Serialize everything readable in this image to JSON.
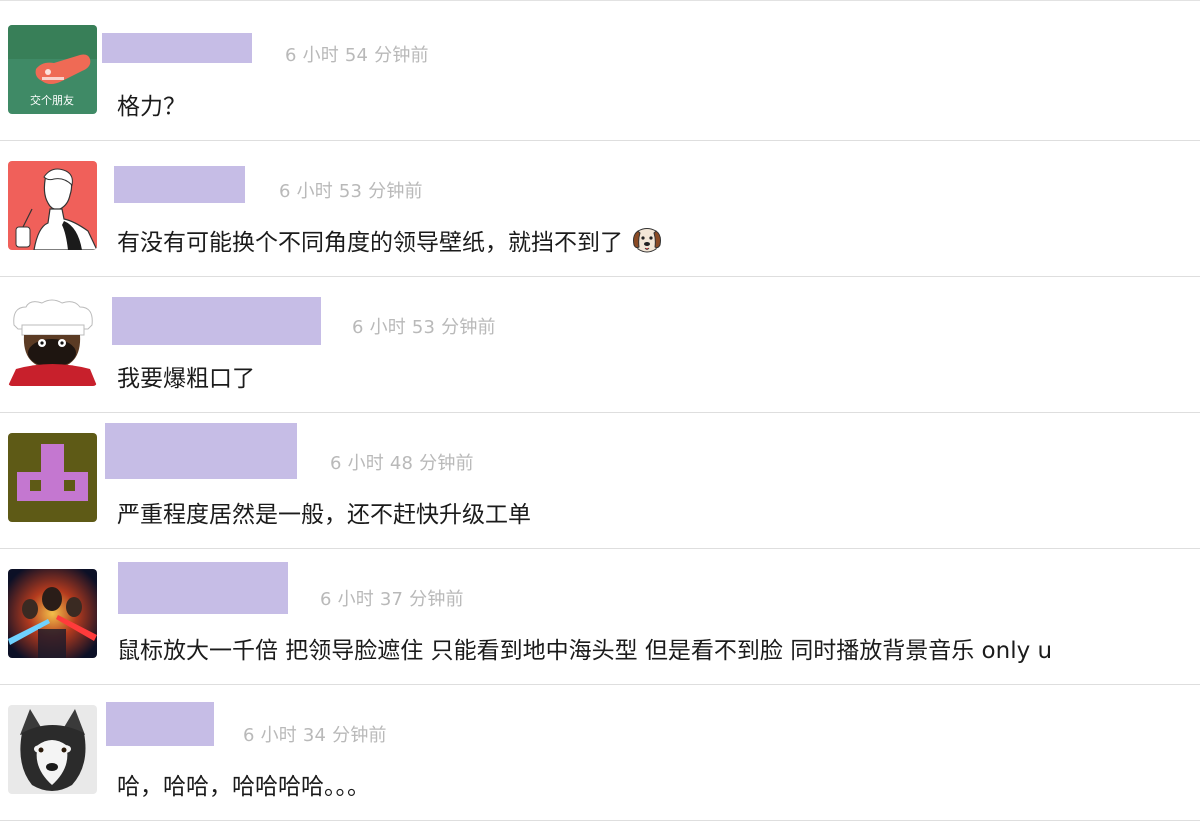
{
  "comments": [
    {
      "avatar_icon": "green-avatar-hand-icon",
      "avatar_text": "交个朋友",
      "time": "6 小时 54 分钟前",
      "content": "格力？"
    },
    {
      "avatar_icon": "red-avatar-sketch-person-icon",
      "time": "6 小时 53 分钟前",
      "content": "有没有可能换个不同角度的领导壁纸，就挡不到了"
    },
    {
      "avatar_icon": "chef-cartoon-avatar-icon",
      "time": "6 小时 53 分钟前",
      "content": "我要爆粗口了"
    },
    {
      "avatar_icon": "purple-pixel-identicon",
      "time": "6 小时 48 分钟前",
      "content": "严重程度居然是一般，还不赶快升级工单"
    },
    {
      "avatar_icon": "starwars-poster-avatar-icon",
      "time": "6 小时 37 分钟前",
      "content": "鼠标放大一千倍 把领导脸遮住 只能看到地中海头型 但是看不到脸 同时播放背景音乐 only u"
    },
    {
      "avatar_icon": "husky-dog-avatar-icon",
      "time": "6 小时 34 分钟前",
      "content": "哈，哈哈，哈哈哈哈。。。"
    }
  ],
  "colors": {
    "name_redaction": "#c6bde6",
    "timestamp": "#b9b9b9",
    "divider": "#dedede"
  }
}
